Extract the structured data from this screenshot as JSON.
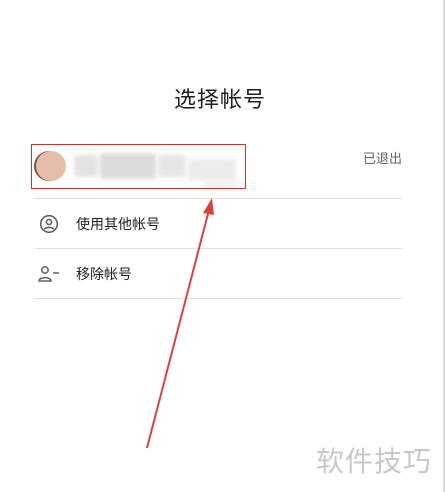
{
  "header": {
    "title": "选择帐号"
  },
  "account": {
    "status": "已退出"
  },
  "menu": {
    "items": [
      {
        "label": "使用其他帐号",
        "icon": "account-circle-icon"
      },
      {
        "label": "移除帐号",
        "icon": "person-remove-icon"
      }
    ]
  },
  "watermark": {
    "text": "软件技巧"
  },
  "colors": {
    "highlight": "#c0392b",
    "arrow": "#d9423a",
    "text": "#202124",
    "secondary_text": "#5f6368",
    "divider": "#e0e0e0"
  }
}
